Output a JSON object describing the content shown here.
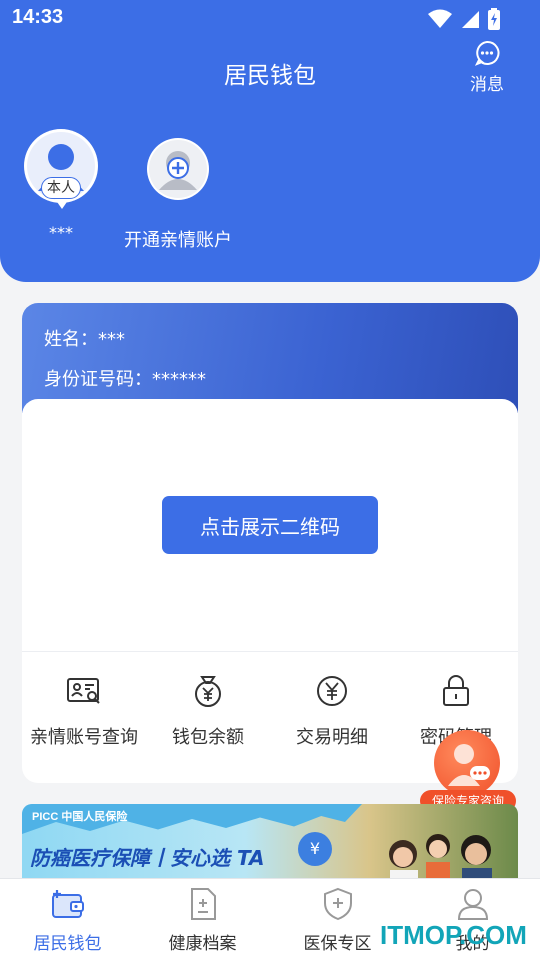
{
  "status_bar": {
    "time": "14:33"
  },
  "header": {
    "title": "居民钱包",
    "message_label": "消息"
  },
  "accounts": {
    "self": {
      "badge": "本人",
      "name": "***"
    },
    "add": {
      "label": "开通亲情账户"
    }
  },
  "card": {
    "name_line": "姓名：***",
    "id_line": "身份证号码：******",
    "qr_button": "点击展示二维码"
  },
  "functions": [
    {
      "label": "亲情账号查询",
      "icon": "id-card-search-icon"
    },
    {
      "label": "钱包余额",
      "icon": "money-bag-icon"
    },
    {
      "label": "交易明细",
      "icon": "yen-circle-icon"
    },
    {
      "label": "密码管理",
      "icon": "lock-icon"
    }
  ],
  "float_consult": {
    "label": "保险专家咨询"
  },
  "banner": {
    "logo": "PICC 中国人民保险",
    "text": "防癌医疗保障丨安心选 TA",
    "coin": "¥"
  },
  "bottom_nav": [
    {
      "label": "居民钱包",
      "icon": "wallet-icon",
      "active": true
    },
    {
      "label": "健康档案",
      "icon": "health-record-icon",
      "active": false
    },
    {
      "label": "医保专区",
      "icon": "shield-plus-icon",
      "active": false
    },
    {
      "label": "我的",
      "icon": "person-icon",
      "active": false
    }
  ],
  "watermark": "ITMOP.COM",
  "colors": {
    "primary": "#3c6ee6",
    "accent": "#f0502a",
    "background": "#f3f4f6"
  }
}
